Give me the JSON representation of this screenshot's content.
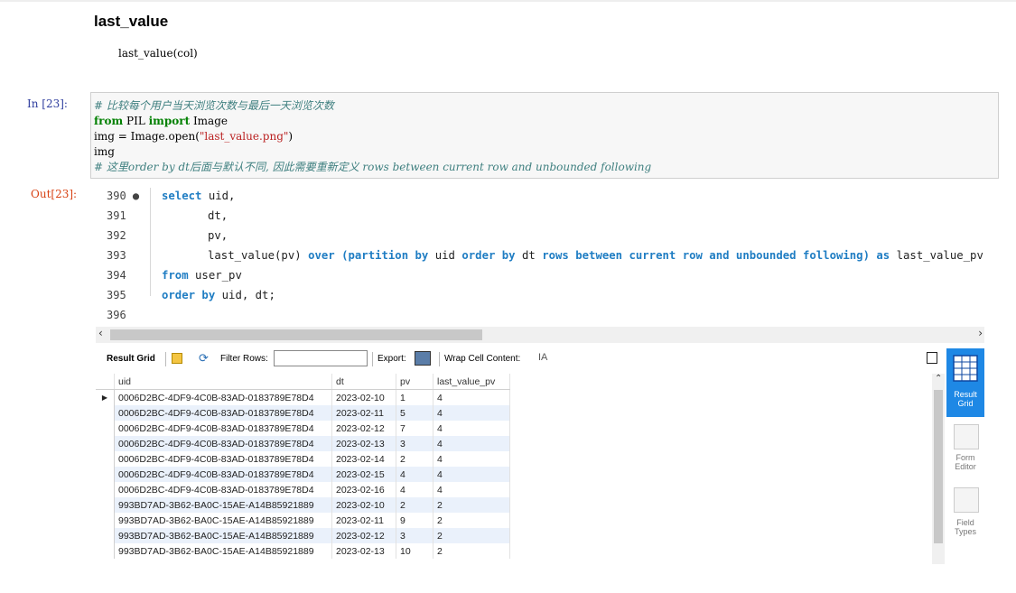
{
  "markdown": {
    "heading": "last_value",
    "signature": "last_value(col)"
  },
  "cell": {
    "in_prompt": "In  [23]:",
    "out_prompt": "Out[23]:",
    "code_lines": [
      "# 比较每个用户当天浏览次数与最后一天浏览次数",
      "from PIL import Image",
      "img = Image.open(\"last_value.png\")",
      "img",
      "# 这里order by dt后面与默认不同, 因此需要重新定义 rows between current row and unbounded following"
    ]
  },
  "editor": {
    "line_numbers": [
      "390 ●",
      "391",
      "392",
      "393",
      "394",
      "395",
      "396"
    ],
    "sql": {
      "l390": [
        "select",
        " uid,"
      ],
      "l391": "dt,",
      "l392": "pv,",
      "l393_fn": "last_value(pv) ",
      "l393_kw1": "over (partition by",
      "l393_mid1": " uid ",
      "l393_kw2": "order by",
      "l393_mid2": " dt ",
      "l393_kw3": "rows between current row and unbounded following)",
      "l393_kw4": " as",
      "l393_end": " last_value_pv",
      "l394_kw": "from",
      "l394_rest": " user_pv",
      "l395_kw": "order by",
      "l395_rest": " uid, dt;"
    }
  },
  "toolbar": {
    "result_grid": "Result Grid",
    "filter_rows": "Filter Rows:",
    "export": "Export:",
    "wrap_cell": "Wrap Cell Content:",
    "wrap_icon": "IA"
  },
  "grid": {
    "columns": [
      "uid",
      "dt",
      "pv",
      "last_value_pv"
    ],
    "rows": [
      [
        "0006D2BC-4DF9-4C0B-83AD-0183789E78D4",
        "2023-02-10",
        "1",
        "4"
      ],
      [
        "0006D2BC-4DF9-4C0B-83AD-0183789E78D4",
        "2023-02-11",
        "5",
        "4"
      ],
      [
        "0006D2BC-4DF9-4C0B-83AD-0183789E78D4",
        "2023-02-12",
        "7",
        "4"
      ],
      [
        "0006D2BC-4DF9-4C0B-83AD-0183789E78D4",
        "2023-02-13",
        "3",
        "4"
      ],
      [
        "0006D2BC-4DF9-4C0B-83AD-0183789E78D4",
        "2023-02-14",
        "2",
        "4"
      ],
      [
        "0006D2BC-4DF9-4C0B-83AD-0183789E78D4",
        "2023-02-15",
        "4",
        "4"
      ],
      [
        "0006D2BC-4DF9-4C0B-83AD-0183789E78D4",
        "2023-02-16",
        "4",
        "4"
      ],
      [
        "993BD7AD-3B62-BA0C-15AE-A14B85921889",
        "2023-02-10",
        "2",
        "2"
      ],
      [
        "993BD7AD-3B62-BA0C-15AE-A14B85921889",
        "2023-02-11",
        "9",
        "2"
      ],
      [
        "993BD7AD-3B62-BA0C-15AE-A14B85921889",
        "2023-02-12",
        "3",
        "2"
      ],
      [
        "993BD7AD-3B62-BA0C-15AE-A14B85921889",
        "2023-02-13",
        "10",
        "2"
      ]
    ]
  },
  "side_panel": {
    "items": [
      [
        "Result",
        "Grid"
      ],
      [
        "Form",
        "Editor"
      ],
      [
        "Field",
        "Types"
      ]
    ]
  },
  "colors": {
    "in_prompt": "#303f9f",
    "out_prompt": "#d84315",
    "sql_keyword": "#1f7dc3",
    "selected_panel": "#1e88e5"
  }
}
